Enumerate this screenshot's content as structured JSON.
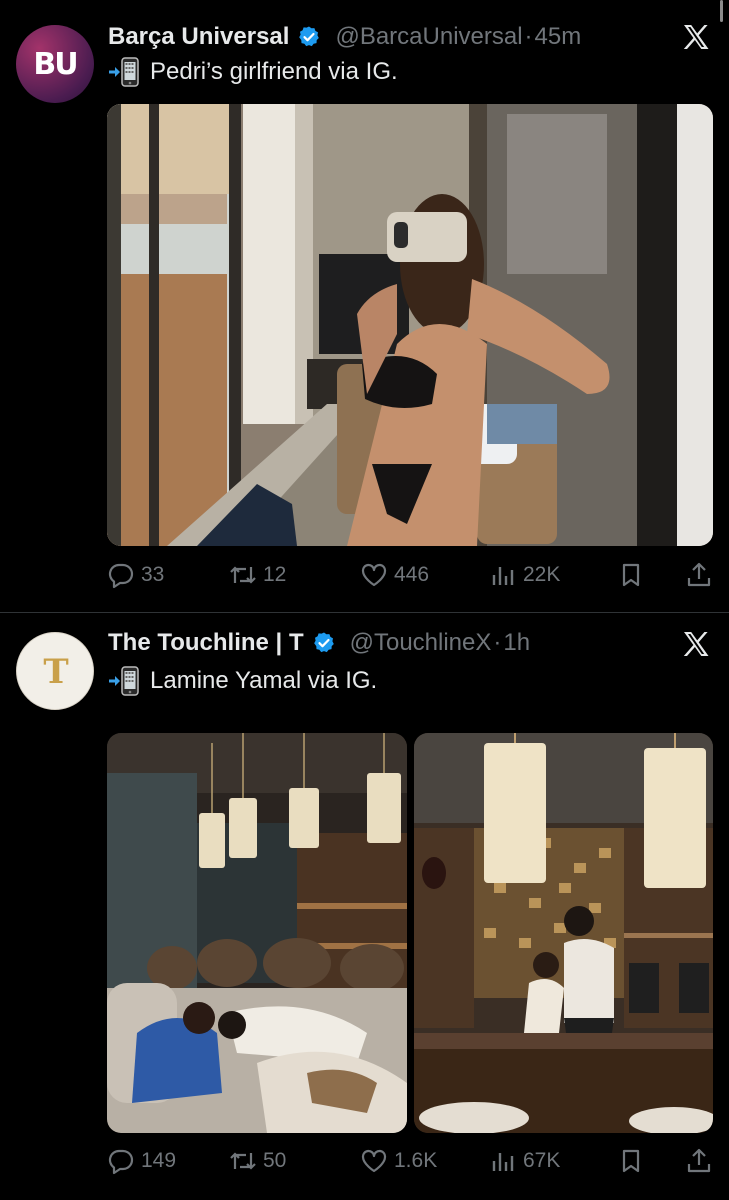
{
  "colors": {
    "background": "#000000",
    "text": "#e7e9ea",
    "muted": "#71767b",
    "verified": "#1d9bf0"
  },
  "tweets": [
    {
      "avatar_text": "BU",
      "name": "Barça Universal",
      "verified": true,
      "handle": "@BarcaUniversal",
      "separator": "·",
      "time": "45m",
      "text": "Pedri’s girlfriend via IG.",
      "icons": {
        "prefix": "mobile-phone-arrow-icon",
        "source": "x-logo-icon"
      },
      "media": [
        {
          "kind": "photo",
          "alt_icon": "photo-selfie"
        }
      ],
      "actions": {
        "replies": "33",
        "retweets": "12",
        "likes": "446",
        "views": "22K"
      }
    },
    {
      "avatar_text": "T",
      "name": "The Touchline | T",
      "verified": true,
      "handle": "@TouchlineX",
      "separator": "·",
      "time": "1h",
      "text": "Lamine Yamal via IG.",
      "icons": {
        "prefix": "mobile-phone-arrow-icon",
        "source": "x-logo-icon"
      },
      "media": [
        {
          "kind": "photo",
          "alt_icon": "photo-lounge"
        },
        {
          "kind": "photo",
          "alt_icon": "photo-bar"
        }
      ],
      "actions": {
        "replies": "149",
        "retweets": "50",
        "likes": "1.6K",
        "views": "67K"
      }
    }
  ]
}
